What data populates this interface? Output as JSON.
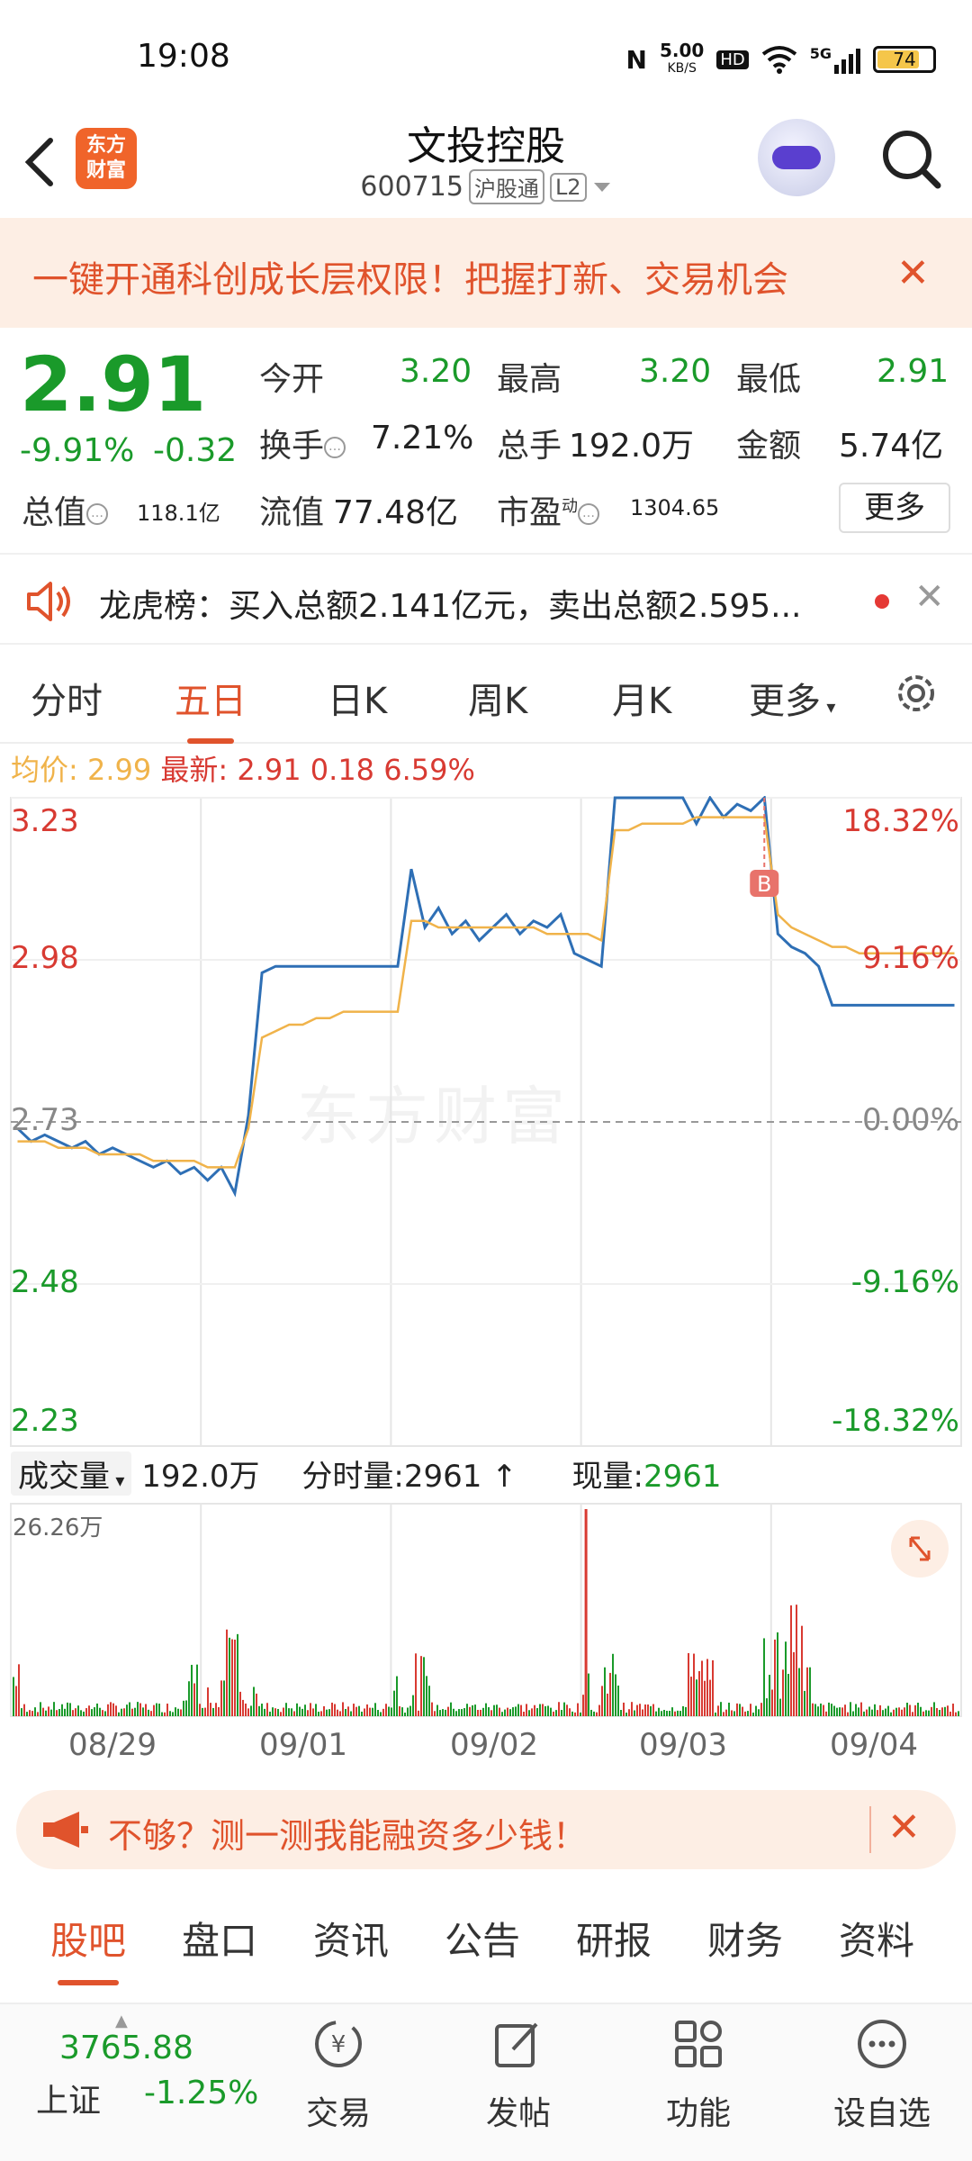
{
  "status_bar": {
    "time": "19:08",
    "net_speed": "5.00",
    "net_unit": "KB/S",
    "hd": "HD",
    "signal": "5G",
    "battery": "74"
  },
  "header": {
    "title": "文投控股",
    "code": "600715",
    "badge1": "沪股通",
    "badge2": "L2",
    "logo_line1": "东方",
    "logo_line2": "财富"
  },
  "promo": {
    "text": "一键开通科创成长层权限！把握打新、交易机会",
    "close": "✕"
  },
  "quote": {
    "price": "2.91",
    "change_pct": "-9.91%",
    "change": "-0.32",
    "open_label": "今开",
    "open": "3.20",
    "high_label": "最高",
    "high": "3.20",
    "low_label": "最低",
    "low": "2.91",
    "turnover_label": "换手",
    "turnover": "7.21%",
    "volume_label": "总手",
    "volume": "192.0万",
    "amount_label": "金额",
    "amount": "5.74亿",
    "mktcap_label": "总值",
    "mktcap": "118.1亿",
    "float_label": "流值",
    "float": "77.48亿",
    "pe_label": "市盈",
    "pe_sup": "动",
    "pe": "1304.65",
    "more": "更多"
  },
  "notice": {
    "text": "龙虎榜：买入总额2.141亿元，卖出总额2.595...",
    "close": "✕"
  },
  "chart_tabs": {
    "items": [
      "分时",
      "五日",
      "日K",
      "周K",
      "月K",
      "更多"
    ],
    "active": "五日"
  },
  "avg_line": {
    "avg_label": "均价:",
    "avg_value": "2.99",
    "latest_label": "最新:",
    "latest_value": "2.91",
    "latest_change": "0.18",
    "latest_pct": "6.59%"
  },
  "chart_data": {
    "type": "line",
    "left_axis": [
      "3.23",
      "2.98",
      "2.73",
      "2.48",
      "2.23"
    ],
    "right_axis": [
      "18.32%",
      "9.16%",
      "0.00%",
      "-9.16%",
      "-18.32%"
    ],
    "ylim": [
      2.23,
      3.23
    ],
    "x_dates": [
      "08/29",
      "09/01",
      "09/02",
      "09/03",
      "09/04"
    ],
    "series": [
      {
        "values": [
          2.72,
          2.7,
          2.71,
          2.7,
          2.69,
          2.7,
          2.68,
          2.69,
          2.68,
          2.67,
          2.66,
          2.67,
          2.65,
          2.66,
          2.64,
          2.66,
          2.62,
          2.74,
          2.96,
          2.97,
          2.97,
          2.97,
          2.97,
          2.97,
          2.97,
          2.97,
          2.97,
          2.97,
          2.97,
          3.12,
          3.03,
          3.06,
          3.02,
          3.04,
          3.01,
          3.03,
          3.05,
          3.02,
          3.04,
          3.03,
          3.05,
          2.99,
          2.98,
          2.97,
          3.23,
          3.23,
          3.23,
          3.23,
          3.23,
          3.23,
          3.19,
          3.23,
          3.2,
          3.22,
          3.21,
          3.23,
          3.02,
          3.0,
          2.99,
          2.97,
          2.91,
          2.91,
          2.91,
          2.91,
          2.91,
          2.91,
          2.91,
          2.91,
          2.91,
          2.91
        ]
      },
      {
        "values": [
          2.7,
          2.7,
          2.7,
          2.69,
          2.69,
          2.69,
          2.68,
          2.68,
          2.68,
          2.68,
          2.67,
          2.67,
          2.67,
          2.67,
          2.66,
          2.66,
          2.66,
          2.72,
          2.86,
          2.87,
          2.88,
          2.88,
          2.89,
          2.89,
          2.9,
          2.9,
          2.9,
          2.9,
          2.9,
          3.04,
          3.04,
          3.03,
          3.03,
          3.03,
          3.03,
          3.03,
          3.03,
          3.03,
          3.03,
          3.02,
          3.02,
          3.02,
          3.02,
          3.01,
          3.18,
          3.18,
          3.19,
          3.19,
          3.19,
          3.19,
          3.2,
          3.2,
          3.2,
          3.2,
          3.2,
          3.2,
          3.05,
          3.03,
          3.02,
          3.01,
          3.0,
          3.0,
          2.99,
          2.99,
          2.99,
          2.99,
          2.99,
          2.99,
          2.99,
          2.99
        ]
      }
    ],
    "colors": {
      "price": "#2e6fb5",
      "avg": "#f0b34a",
      "up": "#d83a32",
      "down": "#1a9a2a"
    }
  },
  "watermark": "东方财富",
  "marker": "B",
  "volume": {
    "selector": "成交量",
    "total": "192.0万",
    "tick_label": "分时量:",
    "tick_value": "2961",
    "tick_arrow": "↑",
    "now_label": "现量:",
    "now_value": "2961",
    "max_label": "26.26万"
  },
  "fin_banner": {
    "text": "不够？测一测我能融资多少钱！",
    "close": "✕"
  },
  "bottom_tabs": {
    "items": [
      "股吧",
      "盘口",
      "资讯",
      "公告",
      "研报",
      "财务",
      "资料"
    ],
    "active": "股吧"
  },
  "nav": {
    "index_value": "3765.88",
    "index_name": "上证",
    "index_change": "-1.25%",
    "items": [
      "交易",
      "发帖",
      "功能",
      "设自选"
    ]
  }
}
